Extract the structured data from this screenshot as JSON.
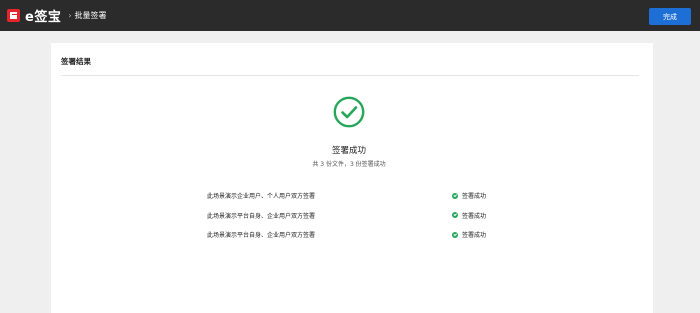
{
  "header": {
    "logo_text": "e签宝",
    "breadcrumb_sep": "›",
    "breadcrumb": "批量签署",
    "done_label": "完成"
  },
  "card": {
    "title": "签署结果",
    "success_title": "签署成功",
    "summary": "共 3 份文件，3 份签署成功"
  },
  "results": [
    {
      "name": "此场景演示企业用户、个人用户双方签署",
      "status": "签署成功"
    },
    {
      "name": "此场景演示平台自身、企业用户双方签署",
      "status": "签署成功"
    },
    {
      "name": "此场景演示平台自身、企业用户双方签署",
      "status": "签署成功"
    }
  ],
  "colors": {
    "topbar": "#2b2b2b",
    "accent": "#1d6fd6",
    "success": "#26a65b",
    "brand": "#e4262c"
  },
  "icons": {
    "logo": "esign-logo-icon",
    "success": "check-circle-icon",
    "row_status": "check-dot-icon"
  }
}
